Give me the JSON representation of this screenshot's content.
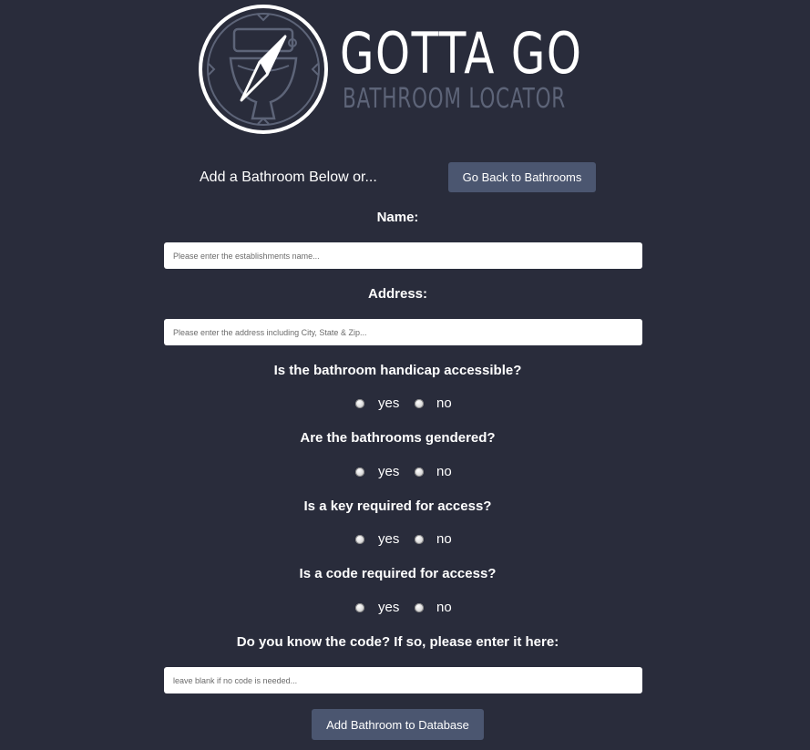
{
  "brand": {
    "title": "GOTTA GO",
    "subtitle": "BATHROOM LOCATOR"
  },
  "header": {
    "intro_text": "Add a Bathroom Below or...",
    "back_button_label": "Go Back to Bathrooms"
  },
  "form": {
    "name": {
      "label": "Name:",
      "value": "",
      "placeholder": "Please enter the establishments name..."
    },
    "address": {
      "label": "Address:",
      "value": "",
      "placeholder": "Please enter the address including City, State & Zip..."
    },
    "questions": [
      {
        "label": "Is the bathroom handicap accessible?",
        "yes": "yes",
        "no": "no",
        "selected": ""
      },
      {
        "label": "Are the bathrooms gendered?",
        "yes": "yes",
        "no": "no",
        "selected": ""
      },
      {
        "label": "Is a key required for access?",
        "yes": "yes",
        "no": "no",
        "selected": ""
      },
      {
        "label": "Is a code required for access?",
        "yes": "yes",
        "no": "no",
        "selected": ""
      }
    ],
    "code": {
      "label": "Do you know the code? If so, please enter it here:",
      "value": "",
      "placeholder": "leave blank if no code is needed..."
    },
    "submit_label": "Add Bathroom to Database"
  },
  "colors": {
    "background": "#292c3b",
    "button": "#4b5670",
    "subtitle": "#5d6478",
    "text": "#ffffff"
  }
}
